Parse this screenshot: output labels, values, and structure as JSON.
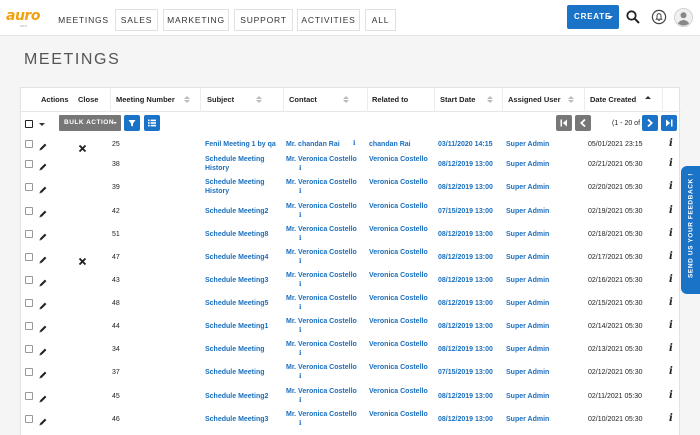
{
  "nav": {
    "logo_text": "auro",
    "logo_sub": "crm",
    "tabs": [
      "MEETINGS",
      "SALES",
      "MARKETING",
      "SUPPORT",
      "ACTIVITIES",
      "ALL"
    ],
    "create_label": "CREATE",
    "icons": [
      "search-icon",
      "notification-icon",
      "user-avatar-icon"
    ]
  },
  "page": {
    "title": "MEETINGS"
  },
  "table": {
    "headers": {
      "actions": "Actions",
      "close": "Close",
      "meeting_number": "Meeting Number",
      "subject": "Subject",
      "contact": "Contact",
      "related_to": "Related to",
      "start_date": "Start Date",
      "assigned_user": "Assigned User",
      "date_created": "Date Created"
    },
    "sorted_by": "date_created",
    "sort_direction": "ascending"
  },
  "toolbar": {
    "bulk_action_label": "BULK ACTION",
    "pagination_text": "(1 - 20 of 58)"
  },
  "rows": [
    {
      "number": "25",
      "subject": [
        "Fenil Meeting 1 by qa"
      ],
      "contact": "Mr. chandan Rai",
      "related": "chandan Rai",
      "start": "03/11/2020 14:15",
      "user": "Super Admin",
      "created": "05/01/2021 23:15",
      "close": true
    },
    {
      "number": "38",
      "subject": [
        "Schedule Meeting",
        "History"
      ],
      "contact": "Mr. Veronica Costello",
      "related": "Veronica Costello",
      "start": "08/12/2019 13:00",
      "user": "Super Admin",
      "created": "02/21/2021 05:30",
      "close": false
    },
    {
      "number": "39",
      "subject": [
        "Schedule Meeting",
        "History"
      ],
      "contact": "Mr. Veronica Costello",
      "related": "Veronica Costello",
      "start": "08/12/2019 13:00",
      "user": "Super Admin",
      "created": "02/20/2021 05:30",
      "close": false
    },
    {
      "number": "42",
      "subject": [
        "Schedule Meeting2"
      ],
      "contact": "Mr. Veronica Costello",
      "related": "Veronica Costello",
      "start": "07/15/2019 13:00",
      "user": "Super Admin",
      "created": "02/19/2021 05:30",
      "close": false
    },
    {
      "number": "51",
      "subject": [
        "Schedule Meeting8"
      ],
      "contact": "Mr. Veronica Costello",
      "related": "Veronica Costello",
      "start": "08/12/2019 13:00",
      "user": "Super Admin",
      "created": "02/18/2021 05:30",
      "close": false
    },
    {
      "number": "47",
      "subject": [
        "Schedule Meeting4"
      ],
      "contact": "Mr. Veronica Costello",
      "related": "Veronica Costello",
      "start": "08/12/2019 13:00",
      "user": "Super Admin",
      "created": "02/17/2021 05:30",
      "close": true
    },
    {
      "number": "43",
      "subject": [
        "Schedule Meeting3"
      ],
      "contact": "Mr. Veronica Costello",
      "related": "Veronica Costello",
      "start": "08/12/2019 13:00",
      "user": "Super Admin",
      "created": "02/16/2021 05:30",
      "close": false
    },
    {
      "number": "48",
      "subject": [
        "Schedule Meeting5"
      ],
      "contact": "Mr. Veronica Costello",
      "related": "Veronica Costello",
      "start": "08/12/2019 13:00",
      "user": "Super Admin",
      "created": "02/15/2021 05:30",
      "close": false
    },
    {
      "number": "44",
      "subject": [
        "Schedule Meeting1"
      ],
      "contact": "Mr. Veronica Costello",
      "related": "Veronica Costello",
      "start": "08/12/2019 13:00",
      "user": "Super Admin",
      "created": "02/14/2021 05:30",
      "close": false
    },
    {
      "number": "34",
      "subject": [
        "Schedule Meeting"
      ],
      "contact": "Mr. Veronica Costello",
      "related": "Veronica Costello",
      "start": "08/12/2019 13:00",
      "user": "Super Admin",
      "created": "02/13/2021 05:30",
      "close": false
    },
    {
      "number": "37",
      "subject": [
        "Schedule Meeting"
      ],
      "contact": "Mr. Veronica Costello",
      "related": "Veronica Costello",
      "start": "07/15/2019 13:00",
      "user": "Super Admin",
      "created": "02/12/2021 05:30",
      "close": false
    },
    {
      "number": "45",
      "subject": [
        "Schedule Meeting2"
      ],
      "contact": "Mr. Veronica Costello",
      "related": "Veronica Costello",
      "start": "08/12/2019 13:00",
      "user": "Super Admin",
      "created": "02/11/2021 05:30",
      "close": false
    },
    {
      "number": "46",
      "subject": [
        "Schedule Meeting3"
      ],
      "contact": "Mr. Veronica Costello",
      "related": "Veronica Costello",
      "start": "08/12/2019 13:00",
      "user": "Super Admin",
      "created": "02/10/2021 05:30",
      "close": false
    }
  ],
  "feedback": {
    "label": "SEND US YOUR FEEDBACK !"
  },
  "colors": {
    "accent": "#1a73c7",
    "link": "#1a6fbf",
    "logo": "#f2a20c",
    "bulk_button": "#777777"
  }
}
